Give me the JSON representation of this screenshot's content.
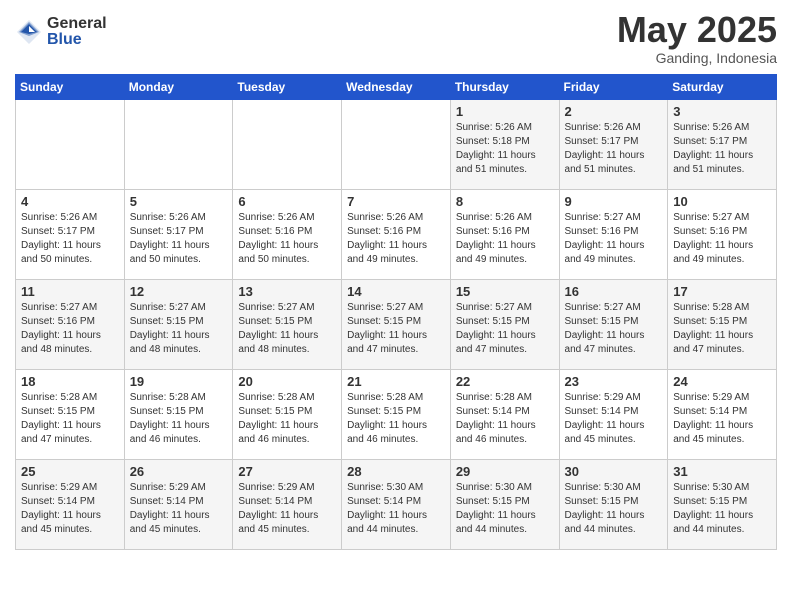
{
  "header": {
    "logo_general": "General",
    "logo_blue": "Blue",
    "month": "May 2025",
    "location": "Ganding, Indonesia"
  },
  "weekdays": [
    "Sunday",
    "Monday",
    "Tuesday",
    "Wednesday",
    "Thursday",
    "Friday",
    "Saturday"
  ],
  "weeks": [
    [
      {
        "day": "",
        "text": ""
      },
      {
        "day": "",
        "text": ""
      },
      {
        "day": "",
        "text": ""
      },
      {
        "day": "",
        "text": ""
      },
      {
        "day": "1",
        "text": "Sunrise: 5:26 AM\nSunset: 5:18 PM\nDaylight: 11 hours\nand 51 minutes."
      },
      {
        "day": "2",
        "text": "Sunrise: 5:26 AM\nSunset: 5:17 PM\nDaylight: 11 hours\nand 51 minutes."
      },
      {
        "day": "3",
        "text": "Sunrise: 5:26 AM\nSunset: 5:17 PM\nDaylight: 11 hours\nand 51 minutes."
      }
    ],
    [
      {
        "day": "4",
        "text": "Sunrise: 5:26 AM\nSunset: 5:17 PM\nDaylight: 11 hours\nand 50 minutes."
      },
      {
        "day": "5",
        "text": "Sunrise: 5:26 AM\nSunset: 5:17 PM\nDaylight: 11 hours\nand 50 minutes."
      },
      {
        "day": "6",
        "text": "Sunrise: 5:26 AM\nSunset: 5:16 PM\nDaylight: 11 hours\nand 50 minutes."
      },
      {
        "day": "7",
        "text": "Sunrise: 5:26 AM\nSunset: 5:16 PM\nDaylight: 11 hours\nand 49 minutes."
      },
      {
        "day": "8",
        "text": "Sunrise: 5:26 AM\nSunset: 5:16 PM\nDaylight: 11 hours\nand 49 minutes."
      },
      {
        "day": "9",
        "text": "Sunrise: 5:27 AM\nSunset: 5:16 PM\nDaylight: 11 hours\nand 49 minutes."
      },
      {
        "day": "10",
        "text": "Sunrise: 5:27 AM\nSunset: 5:16 PM\nDaylight: 11 hours\nand 49 minutes."
      }
    ],
    [
      {
        "day": "11",
        "text": "Sunrise: 5:27 AM\nSunset: 5:16 PM\nDaylight: 11 hours\nand 48 minutes."
      },
      {
        "day": "12",
        "text": "Sunrise: 5:27 AM\nSunset: 5:15 PM\nDaylight: 11 hours\nand 48 minutes."
      },
      {
        "day": "13",
        "text": "Sunrise: 5:27 AM\nSunset: 5:15 PM\nDaylight: 11 hours\nand 48 minutes."
      },
      {
        "day": "14",
        "text": "Sunrise: 5:27 AM\nSunset: 5:15 PM\nDaylight: 11 hours\nand 47 minutes."
      },
      {
        "day": "15",
        "text": "Sunrise: 5:27 AM\nSunset: 5:15 PM\nDaylight: 11 hours\nand 47 minutes."
      },
      {
        "day": "16",
        "text": "Sunrise: 5:27 AM\nSunset: 5:15 PM\nDaylight: 11 hours\nand 47 minutes."
      },
      {
        "day": "17",
        "text": "Sunrise: 5:28 AM\nSunset: 5:15 PM\nDaylight: 11 hours\nand 47 minutes."
      }
    ],
    [
      {
        "day": "18",
        "text": "Sunrise: 5:28 AM\nSunset: 5:15 PM\nDaylight: 11 hours\nand 47 minutes."
      },
      {
        "day": "19",
        "text": "Sunrise: 5:28 AM\nSunset: 5:15 PM\nDaylight: 11 hours\nand 46 minutes."
      },
      {
        "day": "20",
        "text": "Sunrise: 5:28 AM\nSunset: 5:15 PM\nDaylight: 11 hours\nand 46 minutes."
      },
      {
        "day": "21",
        "text": "Sunrise: 5:28 AM\nSunset: 5:15 PM\nDaylight: 11 hours\nand 46 minutes."
      },
      {
        "day": "22",
        "text": "Sunrise: 5:28 AM\nSunset: 5:14 PM\nDaylight: 11 hours\nand 46 minutes."
      },
      {
        "day": "23",
        "text": "Sunrise: 5:29 AM\nSunset: 5:14 PM\nDaylight: 11 hours\nand 45 minutes."
      },
      {
        "day": "24",
        "text": "Sunrise: 5:29 AM\nSunset: 5:14 PM\nDaylight: 11 hours\nand 45 minutes."
      }
    ],
    [
      {
        "day": "25",
        "text": "Sunrise: 5:29 AM\nSunset: 5:14 PM\nDaylight: 11 hours\nand 45 minutes."
      },
      {
        "day": "26",
        "text": "Sunrise: 5:29 AM\nSunset: 5:14 PM\nDaylight: 11 hours\nand 45 minutes."
      },
      {
        "day": "27",
        "text": "Sunrise: 5:29 AM\nSunset: 5:14 PM\nDaylight: 11 hours\nand 45 minutes."
      },
      {
        "day": "28",
        "text": "Sunrise: 5:30 AM\nSunset: 5:14 PM\nDaylight: 11 hours\nand 44 minutes."
      },
      {
        "day": "29",
        "text": "Sunrise: 5:30 AM\nSunset: 5:15 PM\nDaylight: 11 hours\nand 44 minutes."
      },
      {
        "day": "30",
        "text": "Sunrise: 5:30 AM\nSunset: 5:15 PM\nDaylight: 11 hours\nand 44 minutes."
      },
      {
        "day": "31",
        "text": "Sunrise: 5:30 AM\nSunset: 5:15 PM\nDaylight: 11 hours\nand 44 minutes."
      }
    ]
  ]
}
